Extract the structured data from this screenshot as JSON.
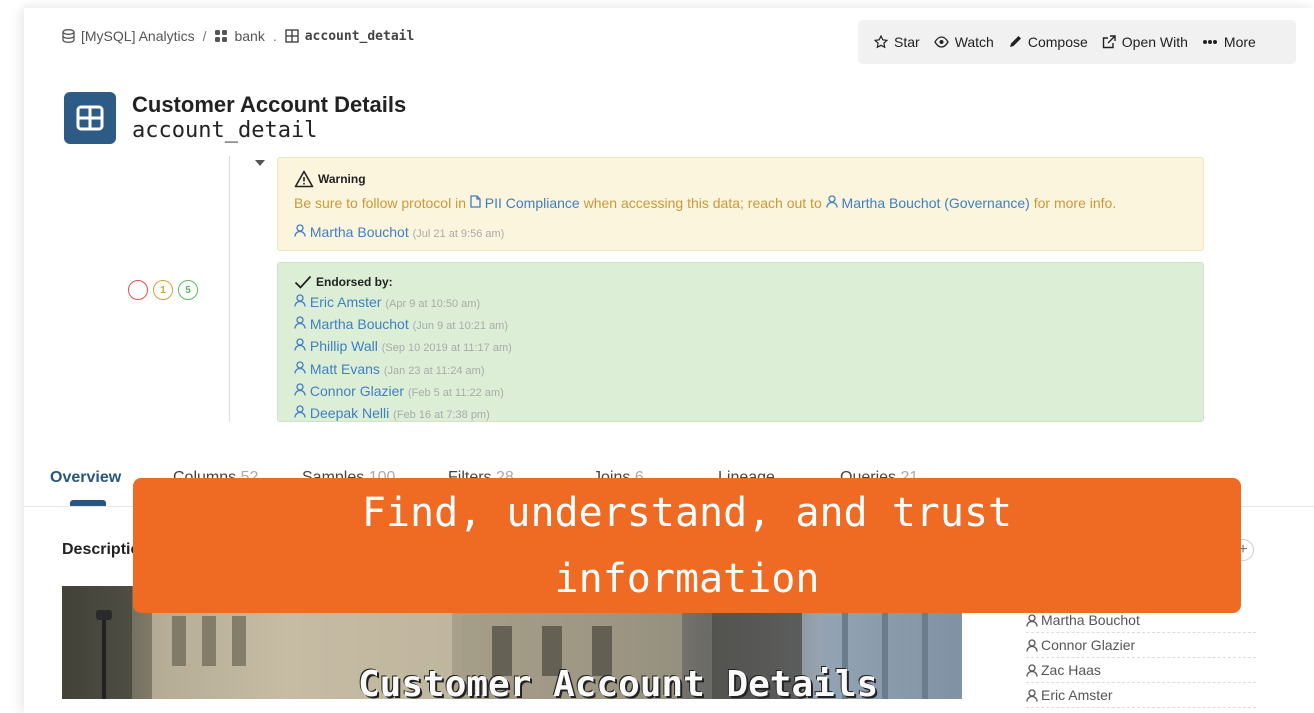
{
  "breadcrumb": {
    "database": "[MySQL] Analytics",
    "separator": "/",
    "schema": "bank",
    "dot": ".",
    "table": "account_detail"
  },
  "toolbar": {
    "star": "Star",
    "watch": "Watch",
    "compose": "Compose",
    "open_with": "Open With",
    "more": "More"
  },
  "header": {
    "title": "Customer Account Details",
    "subtitle": "account_detail"
  },
  "badges": [
    {
      "label": "",
      "color": "#d9534f"
    },
    {
      "label": "1",
      "color": "#e0a030"
    },
    {
      "label": "5",
      "color": "#5cb85c"
    }
  ],
  "warning": {
    "title": "Warning",
    "body_pre": "Be sure to follow protocol in ",
    "doc_link": "PII Compliance",
    "body_mid": " when accessing this data; reach out to ",
    "person_link": "Martha Bouchot (Governance)",
    "body_post": " for more info.",
    "author": "Martha Bouchot",
    "author_time": "(Jul 21 at 9:56 am)"
  },
  "endorsed": {
    "title": "Endorsed by:",
    "people": [
      {
        "name": "Eric Amster",
        "time": "(Apr 9 at 10:50 am)"
      },
      {
        "name": "Martha Bouchot",
        "time": "(Jun 9 at 10:21 am)"
      },
      {
        "name": "Phillip Wall",
        "time": "(Sep 10 2019 at 11:17 am)"
      },
      {
        "name": "Matt Evans",
        "time": "(Jan 23 at 11:24 am)"
      },
      {
        "name": "Connor Glazier",
        "time": "(Feb 5 at 11:22 am)"
      },
      {
        "name": "Deepak Nelli",
        "time": "(Feb 16 at 7:38 pm)"
      }
    ]
  },
  "tabs": [
    {
      "label": "Overview",
      "count": ""
    },
    {
      "label": "Columns",
      "count": "52"
    },
    {
      "label": "Samples",
      "count": "100"
    },
    {
      "label": "Filters",
      "count": "28"
    },
    {
      "label": "Joins",
      "count": "6"
    },
    {
      "label": "Lineage",
      "count": ""
    },
    {
      "label": "Queries",
      "count": "21"
    }
  ],
  "description": {
    "heading": "Description",
    "image_text": "Customer Account Details"
  },
  "owners": [
    "Martha Bouchot",
    "Connor Glazier",
    "Zac Haas",
    "Eric Amster"
  ],
  "banner": {
    "text": "Find, understand, and trust information"
  },
  "colors": {
    "accent": "#2a5580",
    "link": "#3f7fc3",
    "warning_bg": "#fbf5dd",
    "endorse_bg": "#dcefd6",
    "banner_bg": "#ef6a23"
  }
}
